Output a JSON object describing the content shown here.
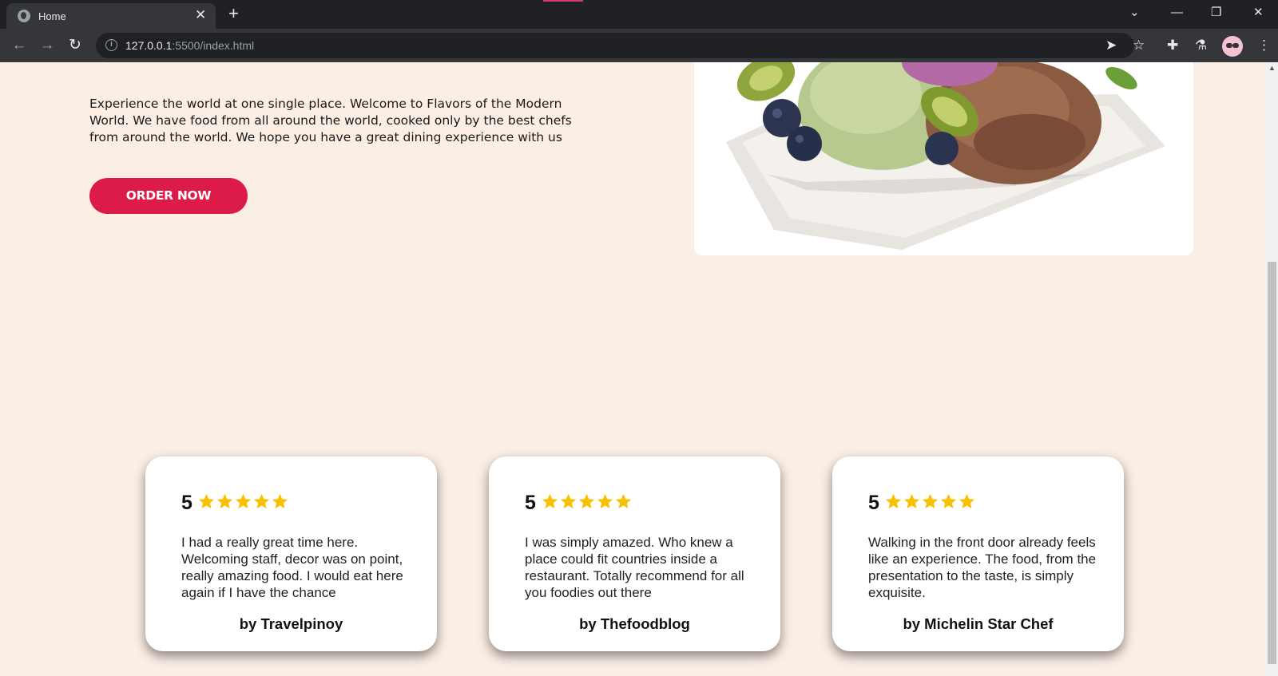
{
  "browser": {
    "tab_title": "Home",
    "tab_close": "✕",
    "new_tab": "+",
    "url_host": "127.0.0.1",
    "url_rest": ":5500/index.html",
    "window_controls": {
      "dropdown": "⌄",
      "minimize": "—",
      "restore": "❐",
      "close": "✕"
    }
  },
  "hero": {
    "intro_text": "Experience the world at one single place. Welcome to Flavors of the Modern World. We have food from all around the world, cooked only by the best chefs from around the world. We hope you have a great dining experience with us",
    "order_button": "ORDER NOW",
    "image_icon": "ice-cream-dessert-image"
  },
  "reviews": [
    {
      "score": "5",
      "stars": 5,
      "text": "I had a really great time here. Welcoming staff, decor was on point, really amazing food. I would eat here again if I have the chance",
      "author": "by Travelpinoy"
    },
    {
      "score": "5",
      "stars": 5,
      "text": "I was simply amazed. Who knew a place could fit countries inside a restaurant. Totally recommend for all you foodies out there",
      "author": "by Thefoodblog"
    },
    {
      "score": "5",
      "stars": 5,
      "text": "Walking in the front door already feels like an experience. The food, from the presentation to the taste, is simply exquisite.",
      "author": "by Michelin Star Chef"
    }
  ],
  "colors": {
    "page_bg": "#faeee5",
    "accent": "#dd1b48",
    "star": "#f8c000"
  }
}
